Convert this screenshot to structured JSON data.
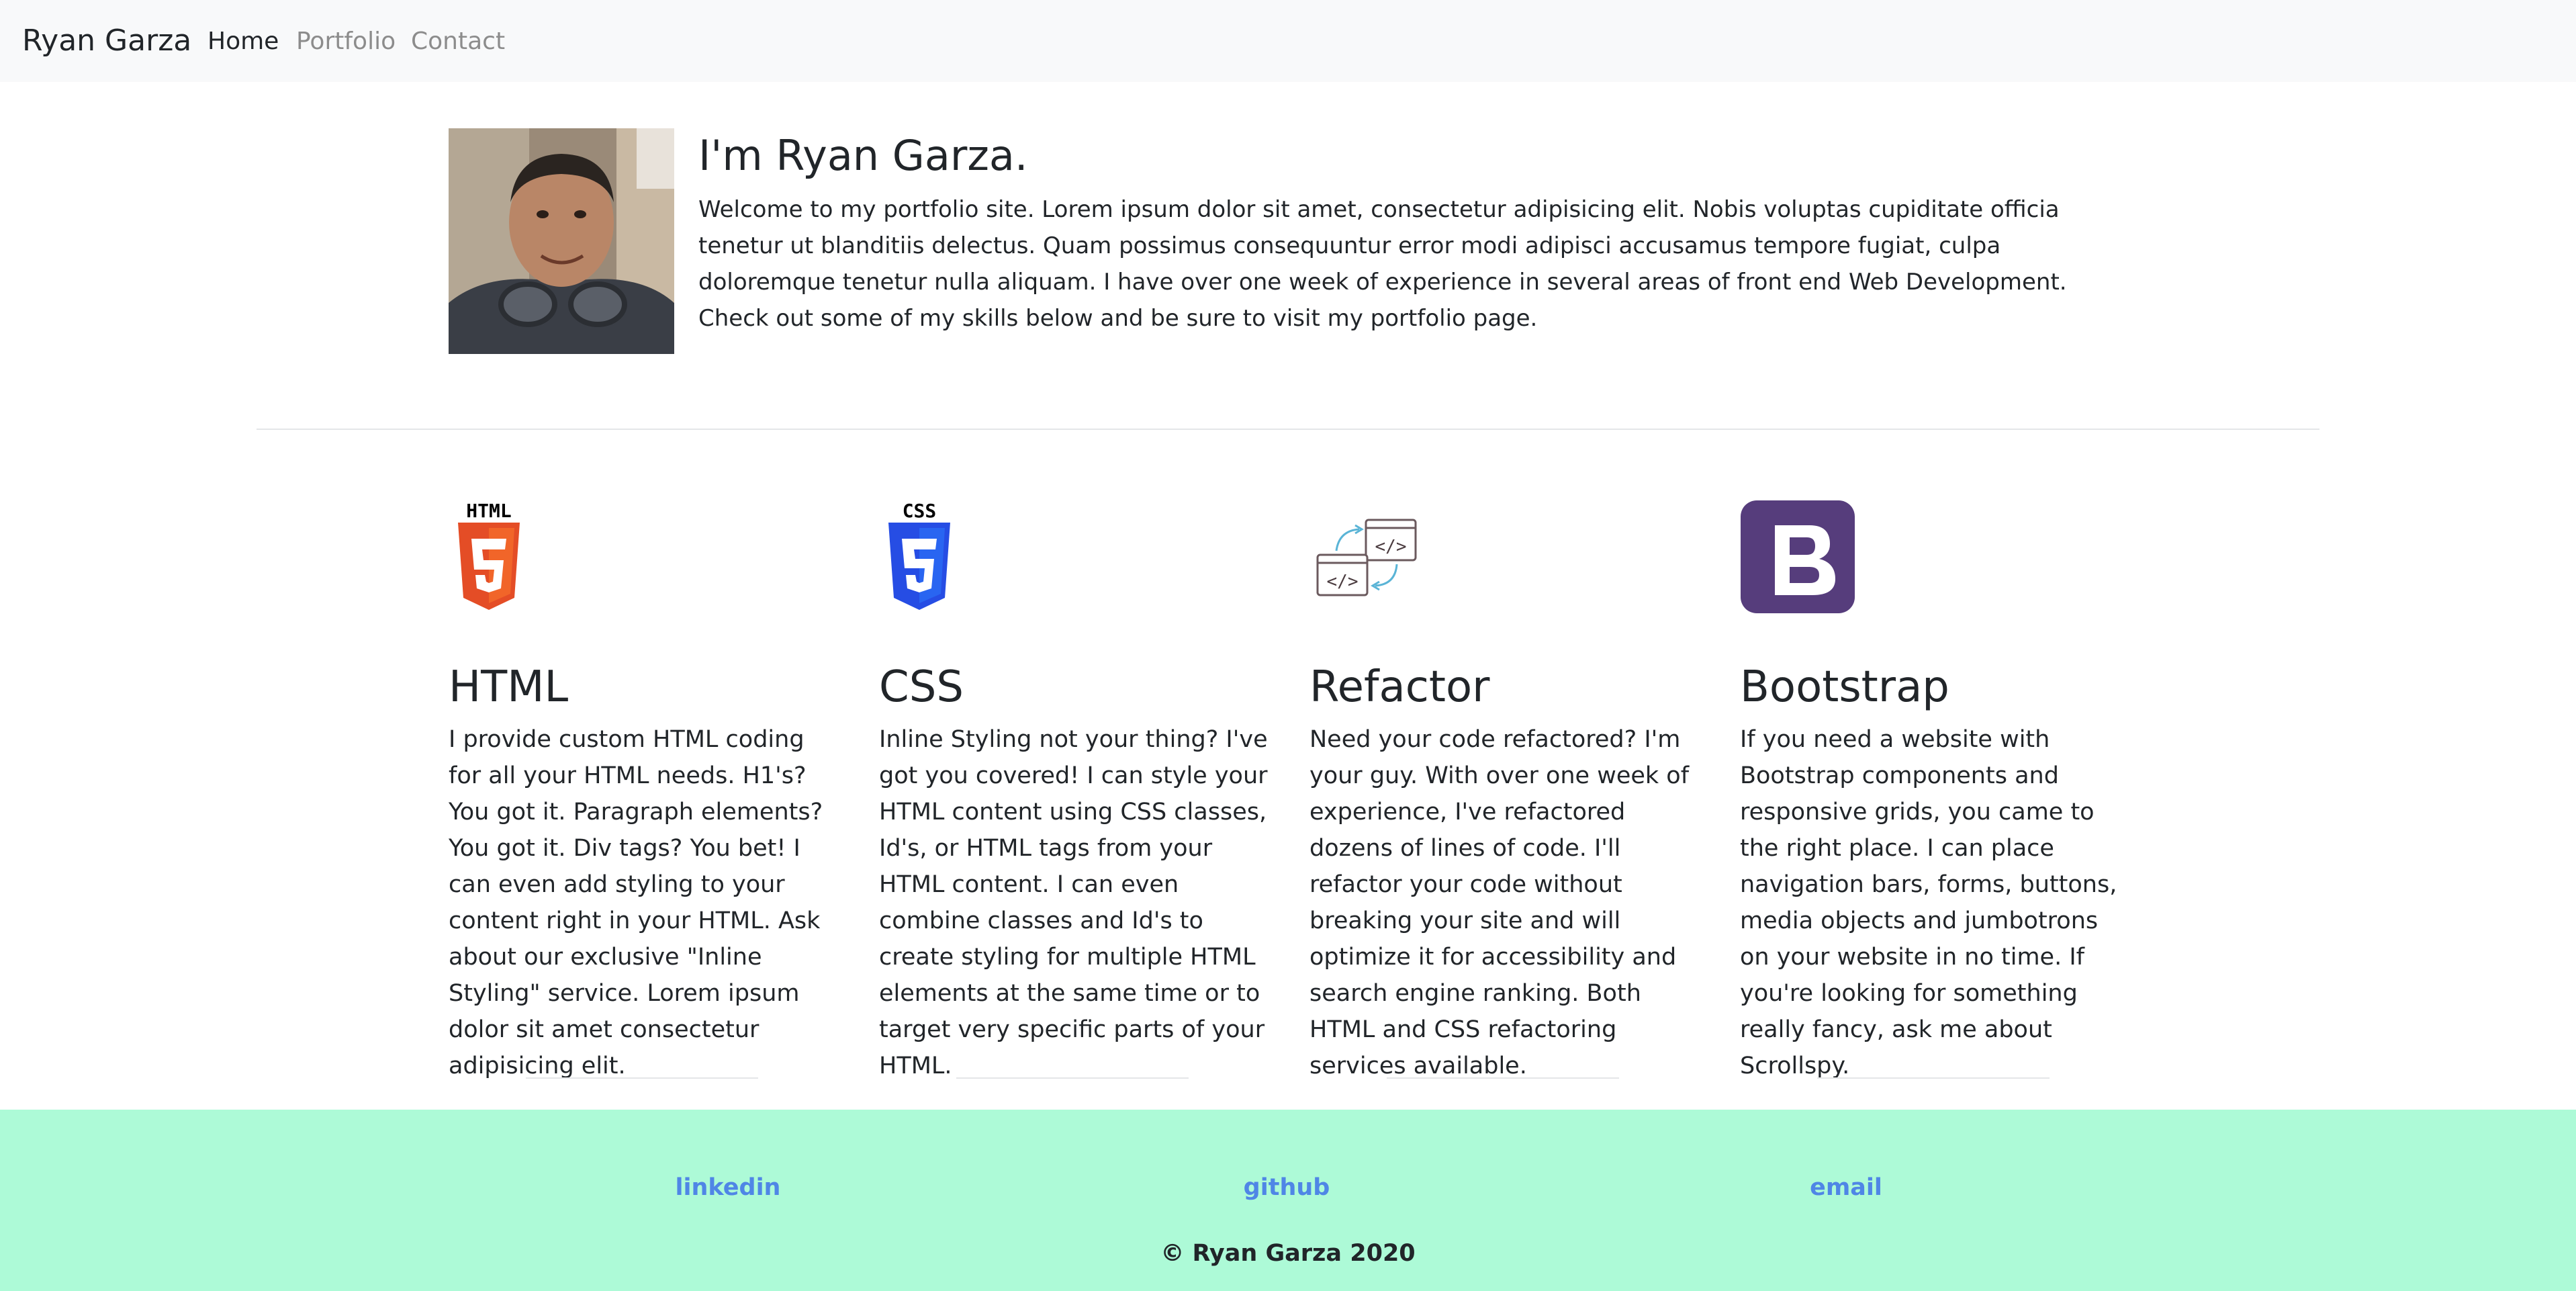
{
  "navbar": {
    "brand": "Ryan Garza",
    "links": [
      {
        "label": "Home",
        "active": true
      },
      {
        "label": "Portfolio",
        "active": false
      },
      {
        "label": "Contact",
        "active": false
      }
    ]
  },
  "intro": {
    "title": "I'm Ryan Garza.",
    "text": "Welcome to my portfolio site. Lorem ipsum dolor sit amet, consectetur adipisicing elit. Nobis voluptas cupiditate officia tenetur ut blanditiis delectus. Quam possimus consequuntur error modi adipisci accusamus tempore fugiat, culpa doloremque tenetur nulla aliquam. I have over one week of experience in several areas of front end Web Development. Check out some of my skills below and be sure to visit my portfolio page."
  },
  "skills": [
    {
      "icon": "html5-icon",
      "icon_label": "HTML",
      "title": "HTML",
      "text": "I provide custom HTML coding for all your HTML needs. H1's? You got it. Paragraph elements? You got it. Div tags? You bet! I can even add styling to your content right in your HTML. Ask about our exclusive \"Inline Styling\" service. Lorem ipsum dolor sit amet consectetur adipisicing elit."
    },
    {
      "icon": "css3-icon",
      "icon_label": "CSS",
      "title": "CSS",
      "text": "Inline Styling not your thing? I've got you covered! I can style your HTML content using CSS classes, Id's, or HTML tags from your HTML content. I can even combine classes and Id's to create styling for multiple HTML elements at the same time or to target very specific parts of your HTML."
    },
    {
      "icon": "refactor-code-icon",
      "title": "Refactor",
      "text": "Need your code refactored? I'm your guy. With over one week of experience, I've refactored dozens of lines of code. I'll refactor your code without breaking your site and will optimize it for accessibility and search engine ranking. Both HTML and CSS refactoring services available."
    },
    {
      "icon": "bootstrap-icon",
      "title": "Bootstrap",
      "text": "If you need a website with Bootstrap components and responsive grids, you came to the right place. I can place navigation bars, forms, buttons, media objects and jumbotrons on your website in no time. If you're looking for something really fancy, ask me about Scrollspy."
    }
  ],
  "footer": {
    "links": [
      "linkedin",
      "github",
      "email"
    ],
    "copyright": "© Ryan Garza 2020"
  },
  "colors": {
    "navbar_bg": "#f8f9fa",
    "footer_bg": "#adfad7",
    "footer_link": "#4f86e6",
    "html_orange": "#e44d26",
    "css_blue": "#264de4",
    "bootstrap_purple": "#563d7c"
  }
}
